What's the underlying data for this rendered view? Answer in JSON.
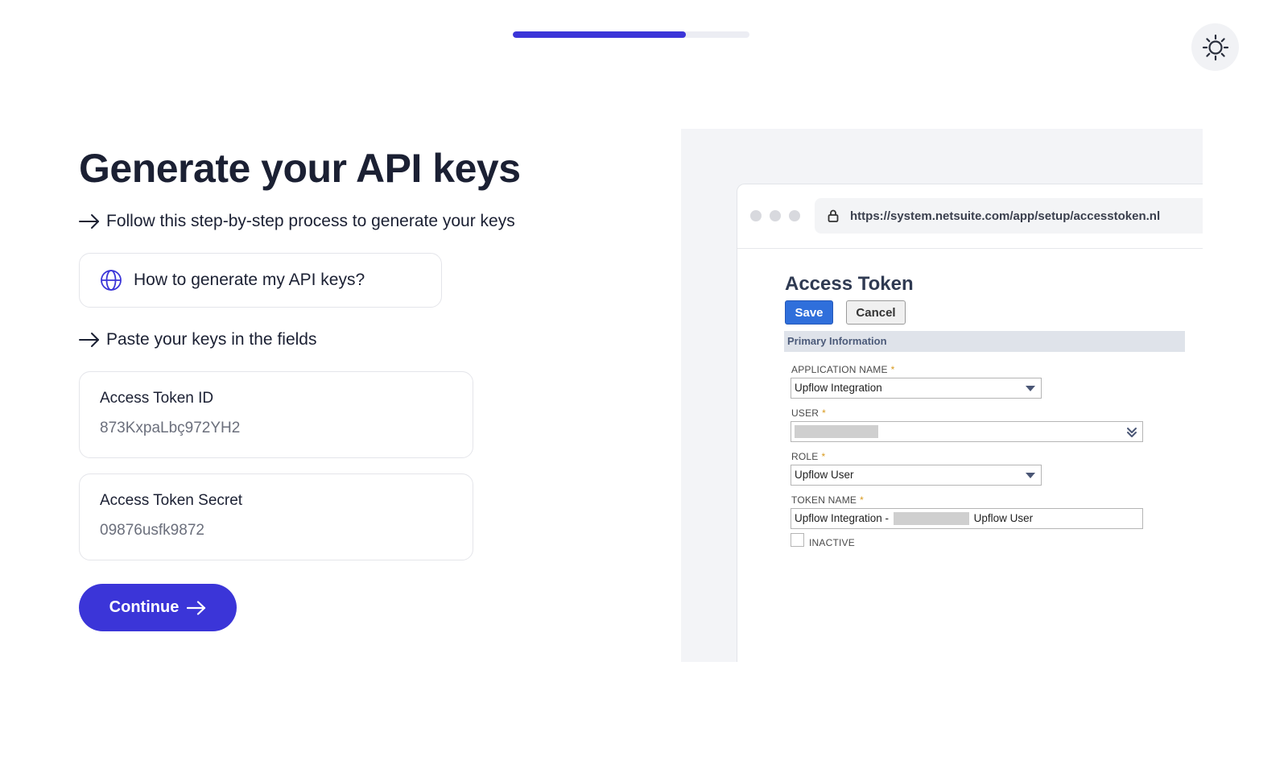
{
  "progress": {
    "fraction": 0.73
  },
  "theme_toggle": {
    "icon": "sun-icon"
  },
  "page": {
    "title": "Generate your API keys",
    "step1": "Follow this step-by-step process to generate your keys",
    "help_link": "How to generate my API keys?",
    "step2": "Paste your keys in the fields"
  },
  "fields": {
    "token_id": {
      "label": "Access Token ID",
      "value": "873KxpaLbç972YH2"
    },
    "token_secret": {
      "label": "Access Token Secret",
      "value": "09876usfk9872"
    }
  },
  "continue_label": "Continue",
  "colors": {
    "accent": "#3b35d8",
    "netsuite_blue": "#2f6fdb"
  },
  "illustration": {
    "url": "https://system.netsuite.com/app/setup/accesstoken.nl",
    "title": "Access Token",
    "save": "Save",
    "cancel": "Cancel",
    "section": "Primary Information",
    "app_name_label": "APPLICATION NAME",
    "app_name_value": "Upflow Integration",
    "user_label": "USER",
    "role_label": "ROLE",
    "role_value": "Upflow User",
    "token_name_label": "TOKEN NAME",
    "token_name_prefix": "Upflow Integration -",
    "token_name_suffix": "Upflow User",
    "inactive_label": "INACTIVE",
    "required_mark": "*"
  }
}
